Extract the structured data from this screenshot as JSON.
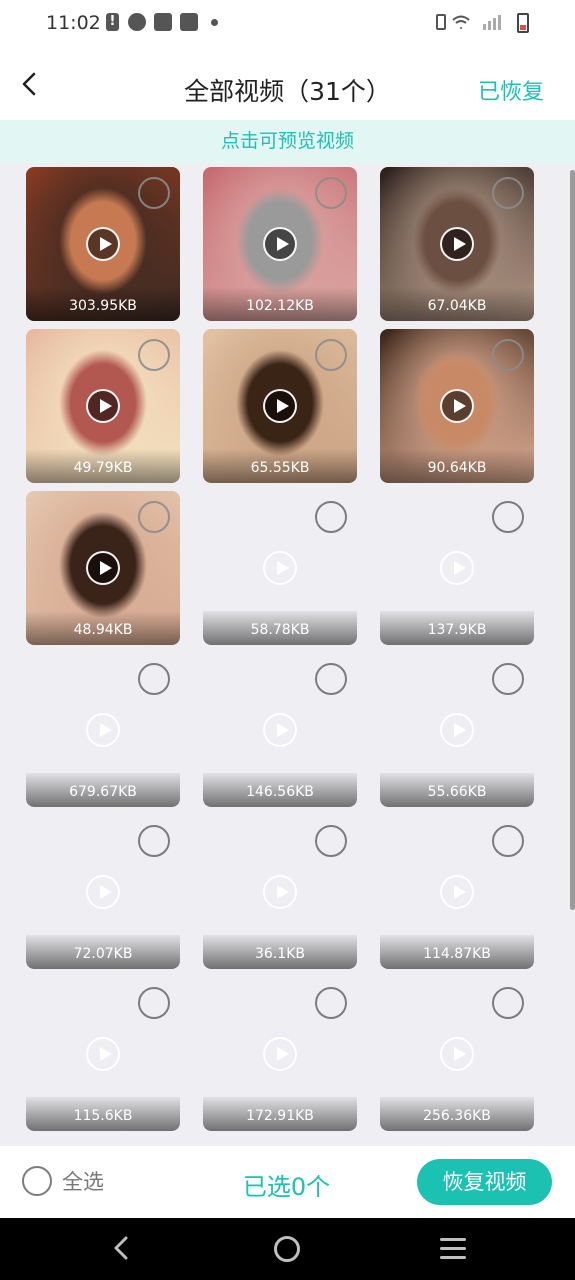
{
  "status_bar": {
    "time": "11:02"
  },
  "header": {
    "title": "全部视频（31个）",
    "recovered_label": "已恢复"
  },
  "tip": "点击可预览视频",
  "videos": [
    {
      "size": "303.95KB",
      "thumb": "photo",
      "palette": [
        "#8a3a22",
        "#c77a52",
        "#3a2a22"
      ]
    },
    {
      "size": "102.12KB",
      "thumb": "photo",
      "palette": [
        "#c7686f",
        "#9a9a9a",
        "#dcaaa5"
      ]
    },
    {
      "size": "67.04KB",
      "thumb": "photo",
      "palette": [
        "#2a1e1a",
        "#6b4f40",
        "#b79c8a"
      ]
    },
    {
      "size": "49.79KB",
      "thumb": "photo",
      "palette": [
        "#e8b8a0",
        "#b35850",
        "#f3e3c0"
      ]
    },
    {
      "size": "65.55KB",
      "thumb": "photo",
      "palette": [
        "#e3c2a4",
        "#3a2416",
        "#caa283"
      ]
    },
    {
      "size": "90.64KB",
      "thumb": "photo",
      "palette": [
        "#3a2418",
        "#c88a66",
        "#e2b096"
      ]
    },
    {
      "size": "48.94KB",
      "thumb": "photo",
      "palette": [
        "#e6c8b0",
        "#3a241a",
        "#d6a890"
      ]
    },
    {
      "size": "58.78KB",
      "thumb": "empty"
    },
    {
      "size": "137.9KB",
      "thumb": "empty"
    },
    {
      "size": "679.67KB",
      "thumb": "empty"
    },
    {
      "size": "146.56KB",
      "thumb": "empty"
    },
    {
      "size": "55.66KB",
      "thumb": "empty"
    },
    {
      "size": "72.07KB",
      "thumb": "empty"
    },
    {
      "size": "36.1KB",
      "thumb": "empty"
    },
    {
      "size": "114.87KB",
      "thumb": "empty"
    },
    {
      "size": "115.6KB",
      "thumb": "empty"
    },
    {
      "size": "172.91KB",
      "thumb": "empty"
    },
    {
      "size": "256.36KB",
      "thumb": "empty"
    }
  ],
  "bottom": {
    "select_all_label": "全选",
    "selected_count": "已选0个",
    "restore_label": "恢复视频"
  },
  "colors": {
    "accent": "#1cc2b1",
    "tip_bg": "#e2f6f4",
    "page_bg": "#efeef3"
  },
  "icons": {
    "back": "chevron-left-icon",
    "play": "play-icon",
    "checkbox": "circle-checkbox-icon"
  }
}
